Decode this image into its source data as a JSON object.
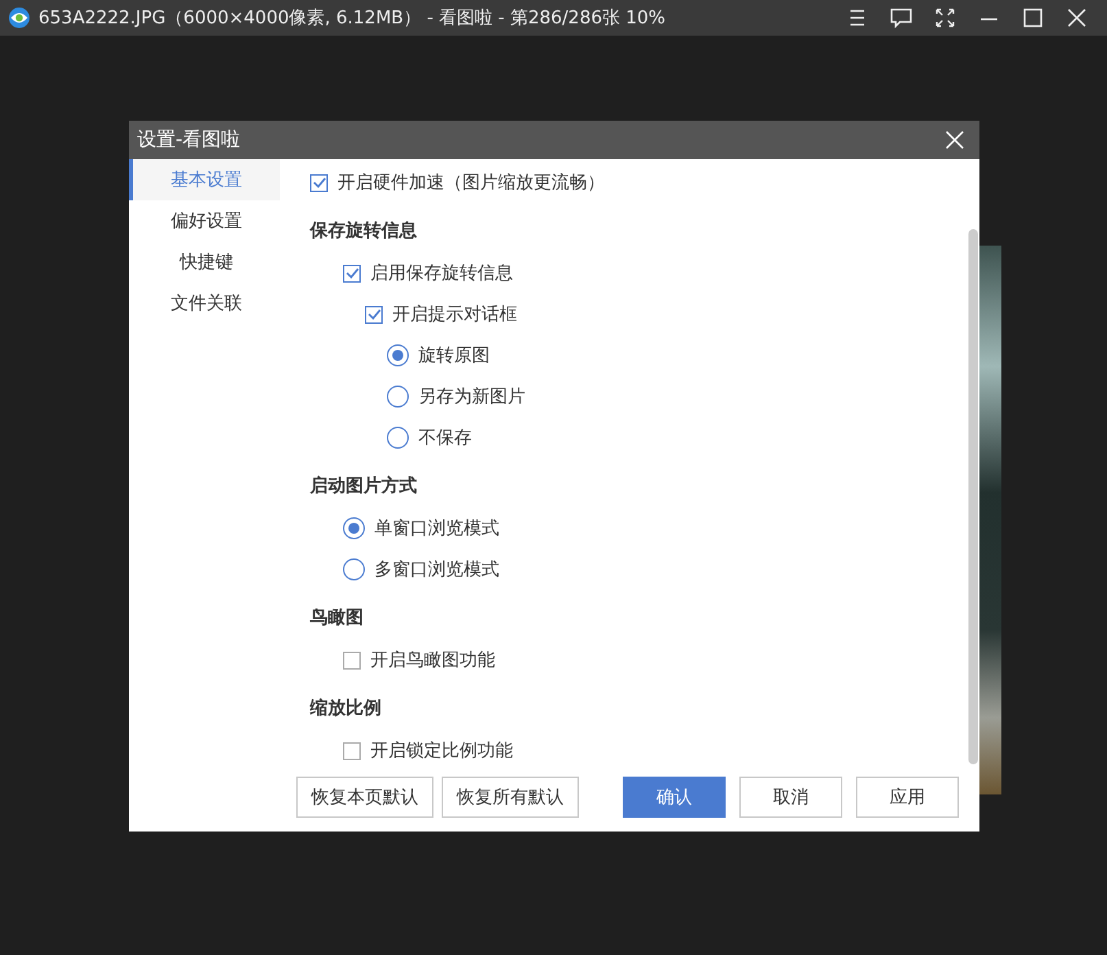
{
  "app_bar": {
    "title": "653A2222.JPG（6000×4000像素, 6.12MB） - 看图啦 - 第286/286张 10%"
  },
  "dialog": {
    "title": "设置-看图啦",
    "sidebar": {
      "items": [
        {
          "label": "基本设置",
          "selected": true
        },
        {
          "label": "偏好设置",
          "selected": false
        },
        {
          "label": "快捷键",
          "selected": false
        },
        {
          "label": "文件关联",
          "selected": false
        }
      ]
    },
    "top_option": {
      "kind": "checkbox",
      "label": "开启硬件加速（图片缩放更流畅）",
      "checked": true
    },
    "sections": [
      {
        "heading": "保存旋转信息",
        "options": [
          {
            "kind": "checkbox",
            "label": "启用保存旋转信息",
            "checked": true,
            "children": [
              {
                "kind": "checkbox",
                "label": "开启提示对话框",
                "checked": true,
                "children": [
                  {
                    "kind": "radio",
                    "label": "旋转原图",
                    "selected": true
                  },
                  {
                    "kind": "radio",
                    "label": "另存为新图片",
                    "selected": false
                  },
                  {
                    "kind": "radio",
                    "label": "不保存",
                    "selected": false
                  }
                ]
              }
            ]
          }
        ]
      },
      {
        "heading": "启动图片方式",
        "options": [
          {
            "kind": "radio",
            "label": "单窗口浏览模式",
            "selected": true
          },
          {
            "kind": "radio",
            "label": "多窗口浏览模式",
            "selected": false
          }
        ]
      },
      {
        "heading": "鸟瞰图",
        "options": [
          {
            "kind": "checkbox",
            "label": "开启鸟瞰图功能",
            "checked": false
          }
        ]
      },
      {
        "heading": "缩放比例",
        "options": [
          {
            "kind": "checkbox",
            "label": "开启锁定比例功能",
            "checked": false
          }
        ]
      }
    ],
    "buttons": [
      {
        "label": "恢复本页默认",
        "kind": "secondary"
      },
      {
        "label": "恢复所有默认",
        "kind": "secondary"
      },
      {
        "label": "确认",
        "kind": "primary"
      },
      {
        "label": "取消",
        "kind": "secondary"
      },
      {
        "label": "应用",
        "kind": "secondary"
      }
    ]
  }
}
